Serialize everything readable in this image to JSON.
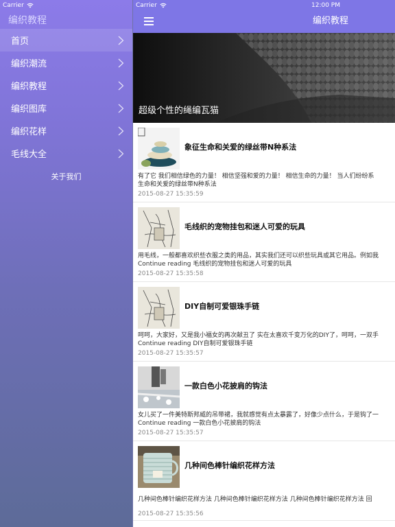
{
  "status": {
    "carrier": "Carrier",
    "time": "12:00 PM"
  },
  "drawer": {
    "title": "编织教程",
    "items": [
      {
        "label": "首页",
        "active": true
      },
      {
        "label": "编织潮流",
        "active": false
      },
      {
        "label": "编织教程",
        "active": false
      },
      {
        "label": "编织图库",
        "active": false
      },
      {
        "label": "编织花样",
        "active": false
      },
      {
        "label": "毛线大全",
        "active": false
      }
    ],
    "about": "关于我们"
  },
  "navbar": {
    "title": "编织教程",
    "menu_icon": "hamburger-icon"
  },
  "banner": {
    "caption": "超级个性的绳编瓦猫"
  },
  "articles": [
    {
      "title": "象征生命和关爱的绿丝带N种系法",
      "excerpt_line1": "有了它 我们相信绿色的力量！ 相信坚强和爱的力量！ 相信生命的力量！ 当人们纷纷系",
      "excerpt_line2": "生命和关爱的绿丝带N种系法",
      "date": "2015-08-27 15:35:59"
    },
    {
      "title": "毛线织的宠物挂包和迷人可爱的玩具",
      "excerpt_line1": "用毛线，一般都喜欢织些衣服之类的用品，其实我们还可以织些玩具或其它用品。例如我",
      "excerpt_line2": "Continue reading 毛线织的宠物挂包和迷人可爱的玩具",
      "date": "2015-08-27 15:35:58"
    },
    {
      "title": "DIY自制可爱银珠手链",
      "excerpt_line1": "呵呵，大家好，又是我小福女的再次献丑了 实在太喜欢千变万化的DIY了，呵呵，一双手",
      "excerpt_line2": "Continue reading DIY自制可爱银珠手链",
      "date": "2015-08-27 15:35:57"
    },
    {
      "title": "一款白色小花披肩的钩法",
      "excerpt_line1": "女儿买了一件美特斯邦威的吊带裙，我就感觉有点太暴露了，好像少点什么，于是钩了一",
      "excerpt_line2": "Continue reading 一款白色小花披肩的钩法",
      "date": "2015-08-27 15:35:57"
    },
    {
      "title": "几种间色棒针编织花样方法",
      "excerpt_line1": " 几种间色棒针编织花样方法 几种间色棒针编织花样方法 几种间色棒针编织花样方法 回",
      "excerpt_line2": "",
      "date": "2015-08-27 15:35:56"
    }
  ],
  "colors": {
    "navbar": "#7e76e6",
    "drawer_top": "#8c7be9",
    "drawer_bottom": "#5d6b98"
  }
}
